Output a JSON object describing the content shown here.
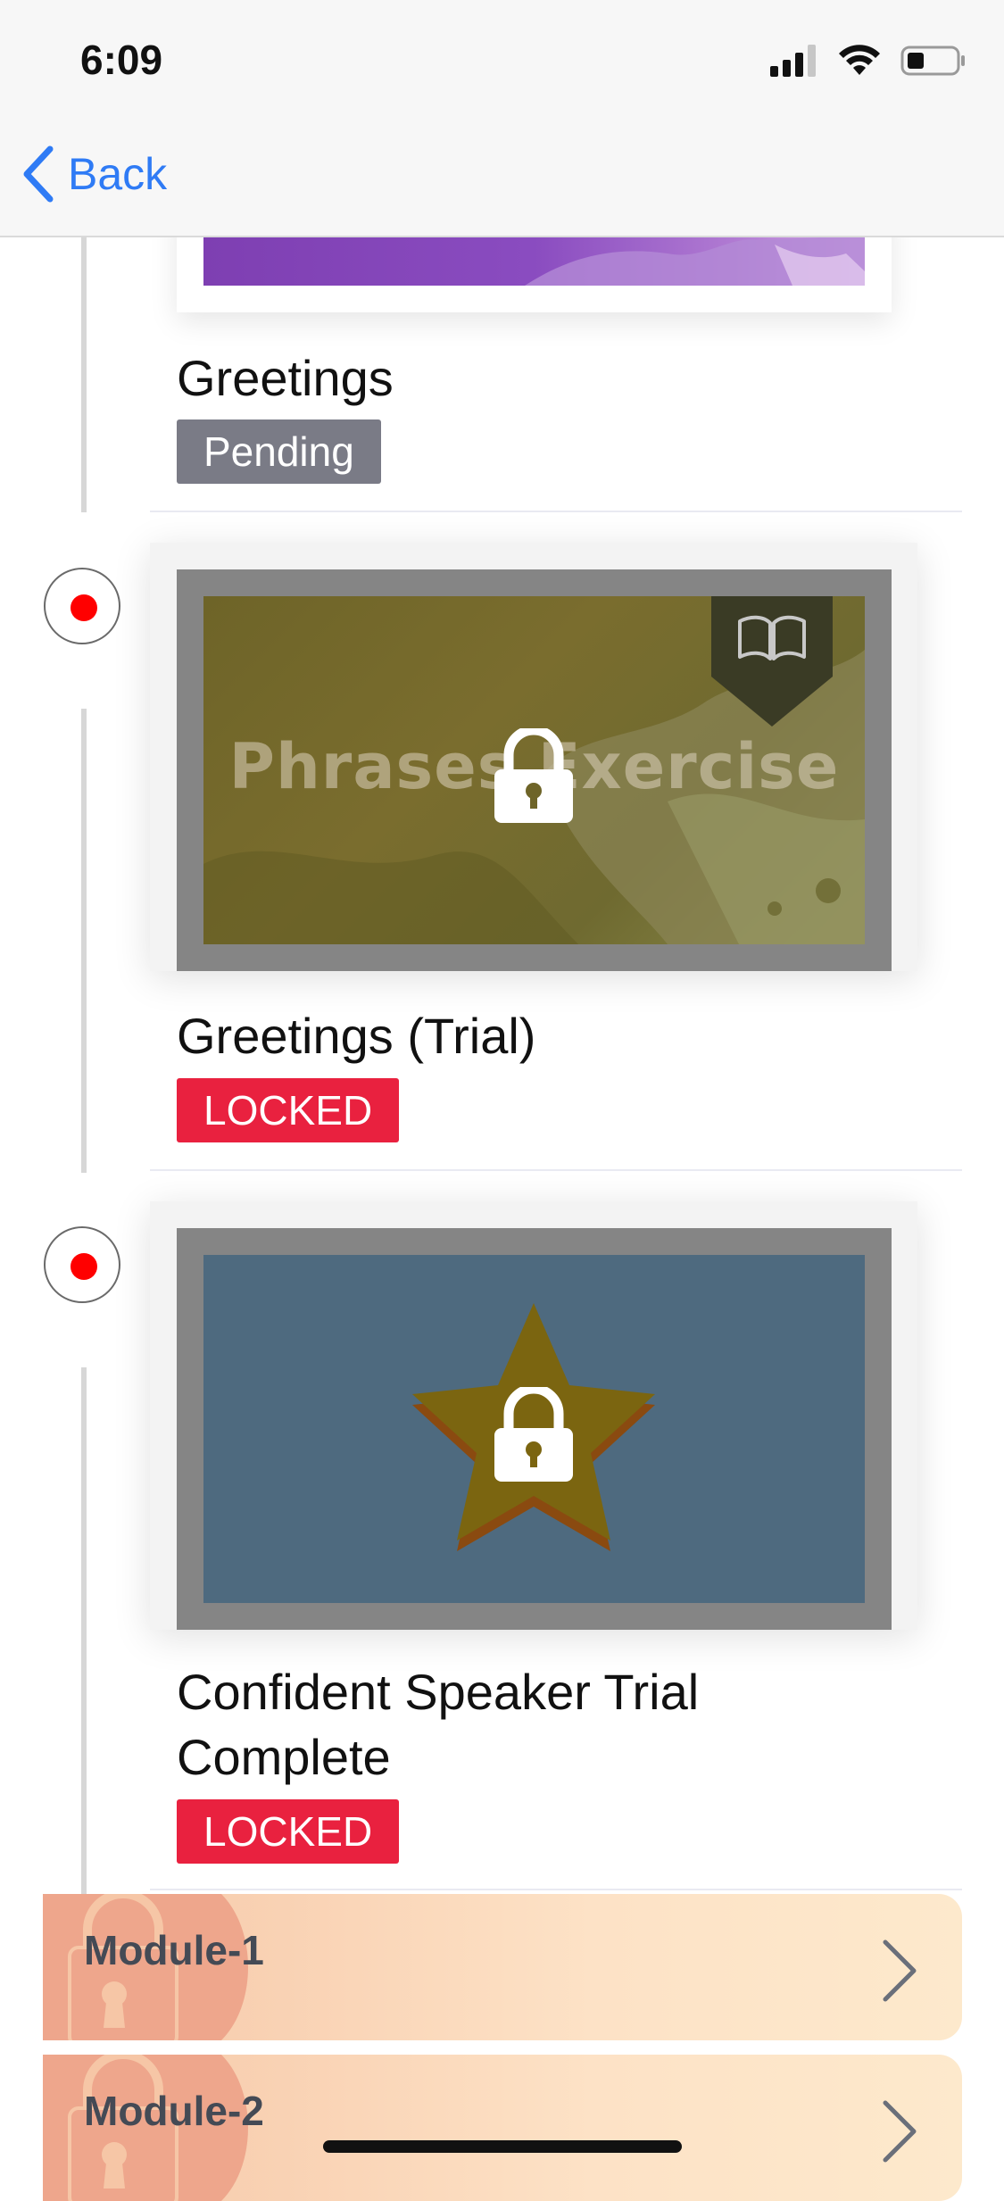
{
  "status_bar": {
    "time": "6:09"
  },
  "nav": {
    "back_label": "Back"
  },
  "items": [
    {
      "title": "Greetings",
      "badge": "Pending"
    },
    {
      "title": "Greetings (Trial)",
      "badge": "LOCKED",
      "thumbnail_text": "Phrases Exercise"
    },
    {
      "title": "Confident Speaker Trial Complete",
      "badge": "LOCKED"
    }
  ],
  "modules": [
    {
      "label": "Module-1"
    },
    {
      "label": "Module-2"
    }
  ],
  "colors": {
    "accent": "#2f7bf5",
    "locked": "#e9213f",
    "pending": "#7a7b86",
    "timeline_dot": "#ff0000"
  }
}
